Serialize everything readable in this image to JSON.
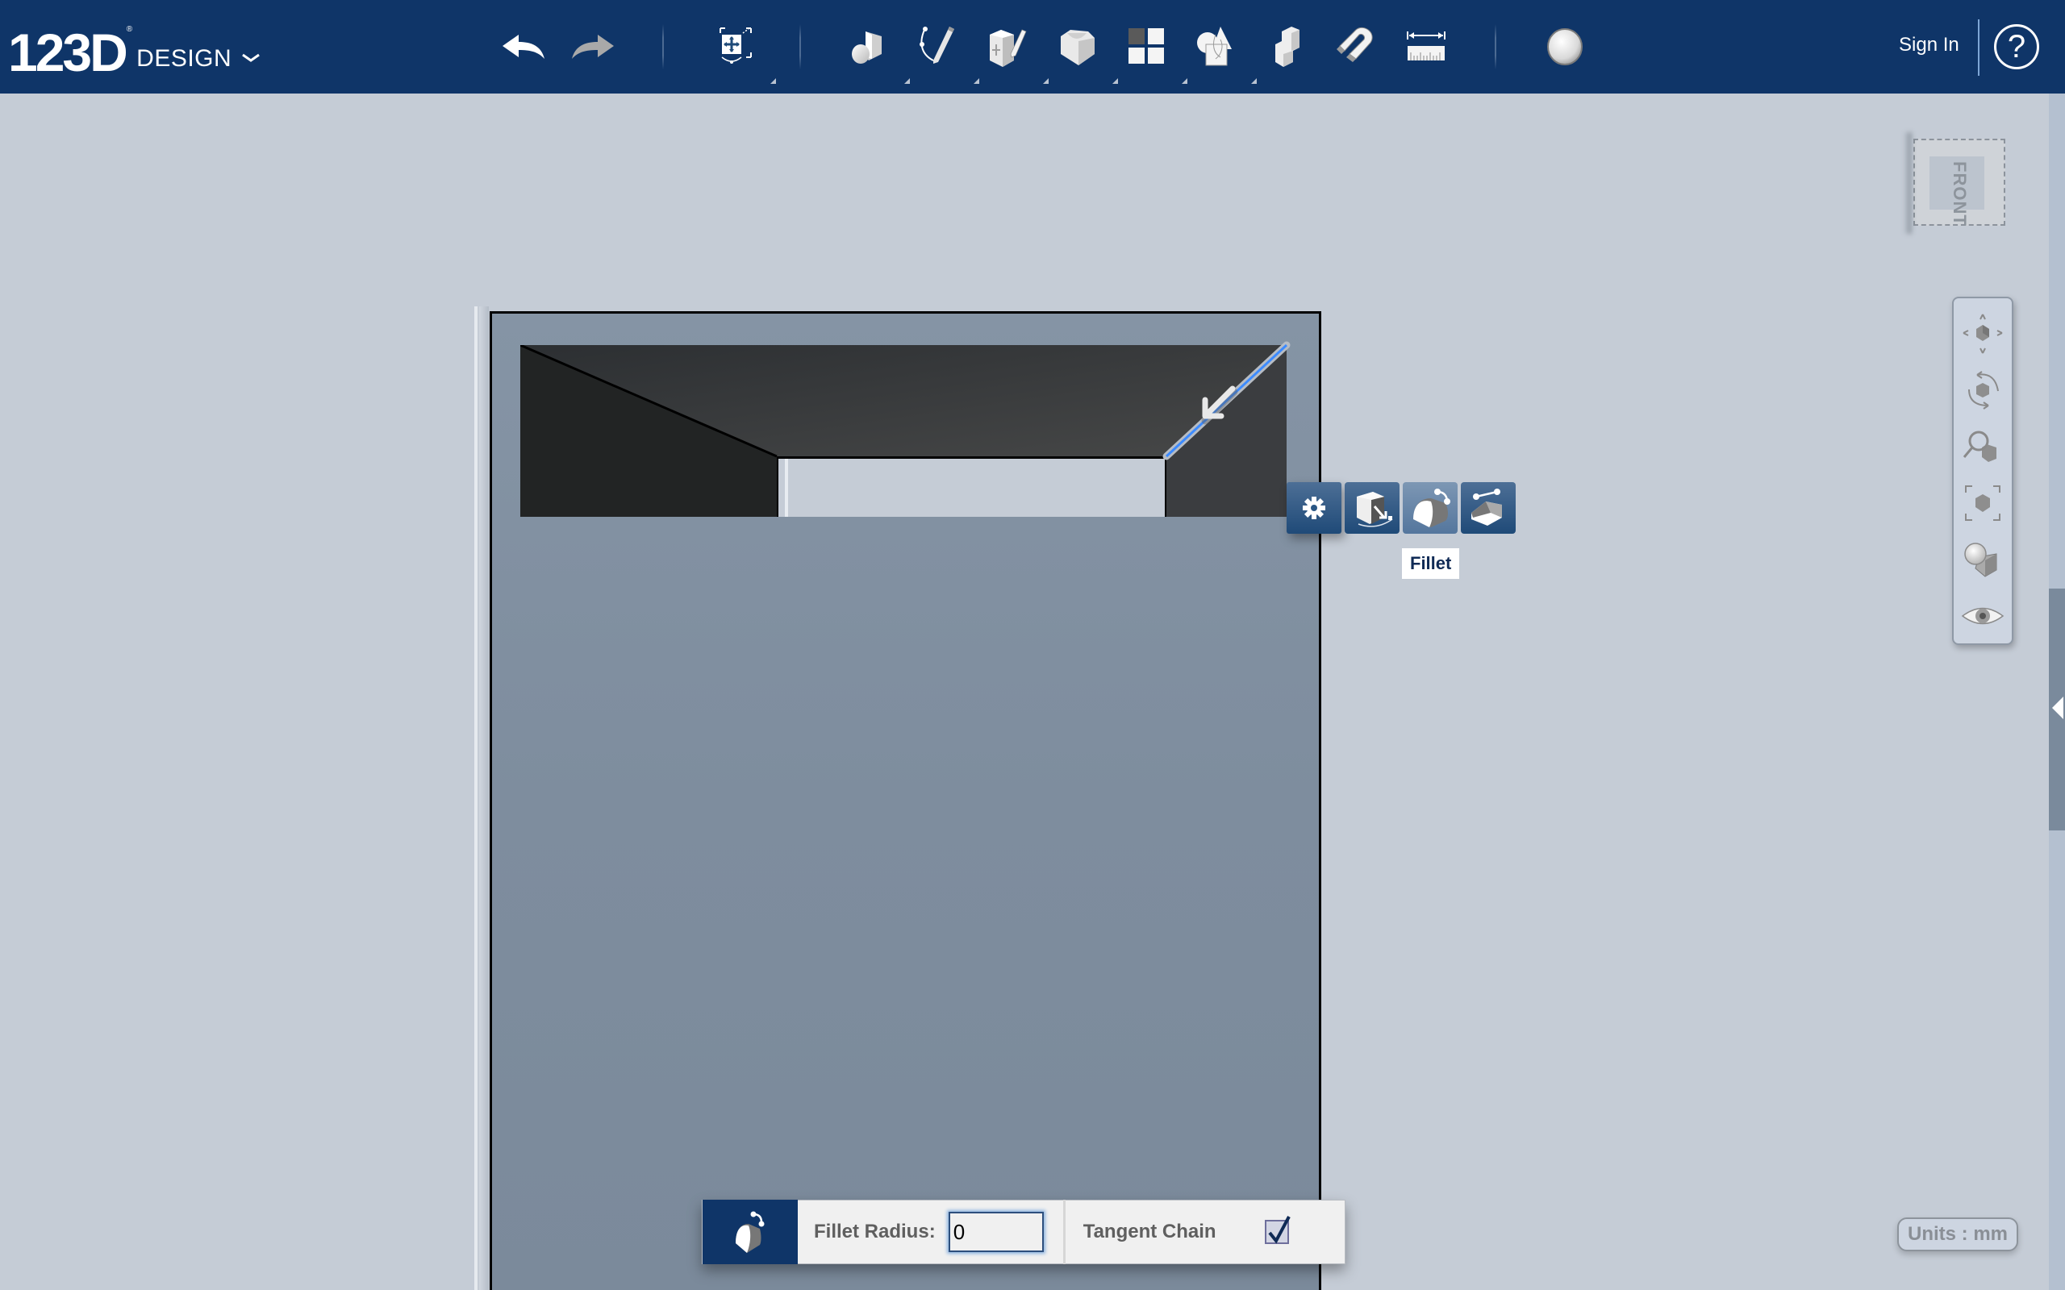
{
  "app": {
    "logo_number": "123D",
    "logo_reg": "®",
    "logo_word": "DESIGN"
  },
  "toolbar": {
    "buttons": [
      {
        "name": "undo",
        "icon": "undo-icon"
      },
      {
        "name": "redo",
        "icon": "redo-icon"
      },
      {
        "name": "transform",
        "icon": "transform-icon",
        "flyout": true
      },
      {
        "name": "primitives",
        "icon": "primitives-icon",
        "flyout": true
      },
      {
        "name": "sketch",
        "icon": "sketch-icon",
        "flyout": true
      },
      {
        "name": "construct",
        "icon": "construct-icon",
        "flyout": true
      },
      {
        "name": "modify",
        "icon": "modify-icon",
        "flyout": true
      },
      {
        "name": "pattern",
        "icon": "pattern-icon",
        "flyout": true
      },
      {
        "name": "grouping",
        "icon": "grouping-icon",
        "flyout": true
      },
      {
        "name": "combine",
        "icon": "combine-icon",
        "flyout": false
      },
      {
        "name": "snap",
        "icon": "snap-magnet-icon",
        "flyout": false
      },
      {
        "name": "measure",
        "icon": "measure-ruler-icon",
        "flyout": false
      },
      {
        "name": "material",
        "icon": "material-sphere-icon",
        "flyout": false
      }
    ],
    "sign_in": "Sign In",
    "help": "?"
  },
  "context_menu": {
    "items": [
      {
        "name": "settings",
        "icon": "gear-icon"
      },
      {
        "name": "press-pull",
        "icon": "press-pull-icon"
      },
      {
        "name": "fillet",
        "icon": "fillet-icon",
        "active": true
      },
      {
        "name": "chamfer",
        "icon": "chamfer-icon"
      }
    ],
    "tooltip": "Fillet"
  },
  "viewcube": {
    "label": "FRONT"
  },
  "navigation": {
    "items": [
      {
        "name": "pan",
        "icon": "pan-icon"
      },
      {
        "name": "orbit",
        "icon": "orbit-icon"
      },
      {
        "name": "zoom",
        "icon": "zoom-icon"
      },
      {
        "name": "fit",
        "icon": "fit-icon"
      },
      {
        "name": "visual-style",
        "icon": "visual-style-icon"
      },
      {
        "name": "visibility",
        "icon": "eye-icon"
      }
    ]
  },
  "units": {
    "label": "Units : mm"
  },
  "fillet_panel": {
    "radius_label": "Fillet Radius:",
    "radius_value": "0",
    "tangent_label": "Tangent Chain",
    "tangent_checked": true
  },
  "colors": {
    "toolbar_bg": "#0f3568",
    "viewport_bg": "#c5ccd6",
    "model_face": "#7f8e9f",
    "selection_edge": "#3d8bff"
  }
}
